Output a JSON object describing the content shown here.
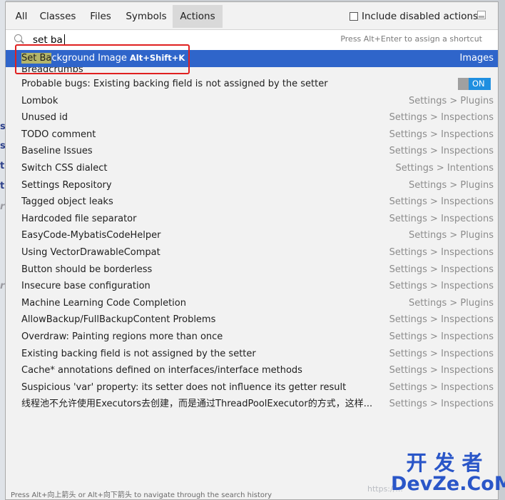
{
  "background": {
    "edge_chars": [
      "s",
      "s",
      "t",
      "t",
      "r",
      "r"
    ]
  },
  "tabs": [
    {
      "label": "All"
    },
    {
      "label": "Classes"
    },
    {
      "label": "Files"
    },
    {
      "label": "Symbols"
    },
    {
      "label": "Actions",
      "active": true
    }
  ],
  "include_disabled": {
    "label": "Include disabled actions",
    "checked": false
  },
  "search": {
    "value": "set ba",
    "hint": "Press Alt+Enter to assign a shortcut"
  },
  "selected_result": {
    "match": "Set Ba",
    "rest": "ckground Image",
    "shortcut": "Alt+Shift+K",
    "location": "Images"
  },
  "partial_result": {
    "name": "Breadcrumbs"
  },
  "toggle_result": {
    "name": "Probable bugs: Existing backing field is not assigned by the setter",
    "toggle": "ON"
  },
  "results": [
    {
      "name": "Lombok",
      "location": "Settings > Plugins"
    },
    {
      "name": "Unused id",
      "location": "Settings > Inspections"
    },
    {
      "name": "TODO comment",
      "location": "Settings > Inspections"
    },
    {
      "name": "Baseline Issues",
      "location": "Settings > Inspections"
    },
    {
      "name": "Switch CSS dialect",
      "location": "Settings > Intentions"
    },
    {
      "name": "Settings Repository",
      "location": "Settings > Plugins"
    },
    {
      "name": "Tagged object leaks",
      "location": "Settings > Inspections"
    },
    {
      "name": "Hardcoded file separator",
      "location": "Settings > Inspections"
    },
    {
      "name": "EasyCode-MybatisCodeHelper",
      "location": "Settings > Plugins"
    },
    {
      "name": "Using VectorDrawableCompat",
      "location": "Settings > Inspections"
    },
    {
      "name": "Button should be borderless",
      "location": "Settings > Inspections"
    },
    {
      "name": "Insecure base configuration",
      "location": "Settings > Inspections"
    },
    {
      "name": "Machine Learning Code Completion",
      "location": "Settings > Plugins"
    },
    {
      "name": "AllowBackup/FullBackupContent Problems",
      "location": "Settings > Inspections"
    },
    {
      "name": "Overdraw: Painting regions more than once",
      "location": "Settings > Inspections"
    },
    {
      "name": "Existing backing field is not assigned by the setter",
      "location": "Settings > Inspections"
    },
    {
      "name": "Cache* annotations defined on interfaces/interface methods",
      "location": "Settings > Inspections"
    },
    {
      "name": "Suspicious 'var' property: its setter does not influence its getter result",
      "location": "Settings > Inspections"
    },
    {
      "name": "线程池不允许使用Executors去创建，而是通过ThreadPoolExecutor的方式，这样...",
      "location": "Settings > Inspections"
    }
  ],
  "status_text": "Press Alt+向上箭头 or Alt+向下箭头 to navigate through the search history",
  "watermark": {
    "cn": "开发者",
    "en": "DevZe.CoM",
    "faint": "https://..."
  },
  "colors": {
    "selection": "#2f65ca",
    "highlight": "#b4b56a",
    "annotation_box": "#e02020",
    "toggle_on": "#1f8fe0"
  }
}
